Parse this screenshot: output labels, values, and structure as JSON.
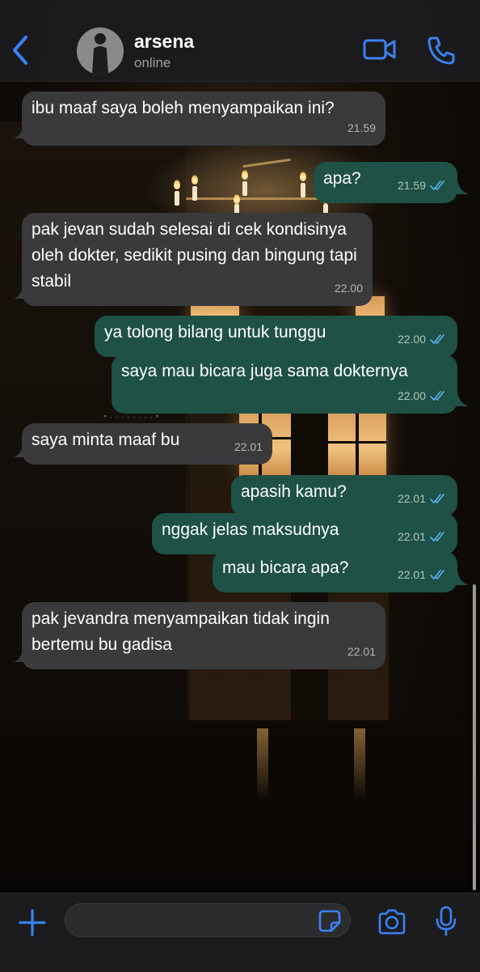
{
  "header": {
    "contact_name": "arsena",
    "status": "online",
    "icons": {
      "back": "chevron-left-icon",
      "video": "video-camera-icon",
      "call": "phone-icon"
    }
  },
  "messages": [
    {
      "direction": "incoming",
      "text": "ibu maaf saya boleh menyampaikan ini?",
      "time": "21.59"
    },
    {
      "direction": "outgoing",
      "text": "apa?",
      "time": "21.59",
      "read": true
    },
    {
      "direction": "incoming",
      "text": "pak jevan sudah selesai di cek kondisinya oleh dokter, sedikit pusing dan bingung tapi stabil",
      "time": "22.00"
    },
    {
      "direction": "outgoing",
      "text": "ya tolong bilang untuk tunggu",
      "time": "22.00",
      "read": true
    },
    {
      "direction": "outgoing",
      "text": "saya mau bicara juga sama dokternya",
      "time": "22.00",
      "read": true
    },
    {
      "direction": "incoming",
      "text": "saya minta maaf bu",
      "time": "22.01"
    },
    {
      "direction": "outgoing",
      "text": "apasih kamu?",
      "time": "22.01",
      "read": true
    },
    {
      "direction": "outgoing",
      "text": "nggak jelas maksudnya",
      "time": "22.01",
      "read": true
    },
    {
      "direction": "outgoing",
      "text": "mau bicara apa?",
      "time": "22.01",
      "read": true
    },
    {
      "direction": "incoming",
      "text": "pak jevandra menyampaikan tidak ingin bertemu bu gadisa",
      "time": "22.01"
    }
  ],
  "composer": {
    "input_value": "",
    "icons": {
      "attach": "plus-icon",
      "sticker": "sticker-icon",
      "camera": "camera-icon",
      "mic": "microphone-icon"
    }
  },
  "colors": {
    "accent": "#3b82f6",
    "incoming_bubble": "#3a3a3c",
    "outgoing_bubble": "#1f5146",
    "read_ticks": "#5aa9e6"
  }
}
